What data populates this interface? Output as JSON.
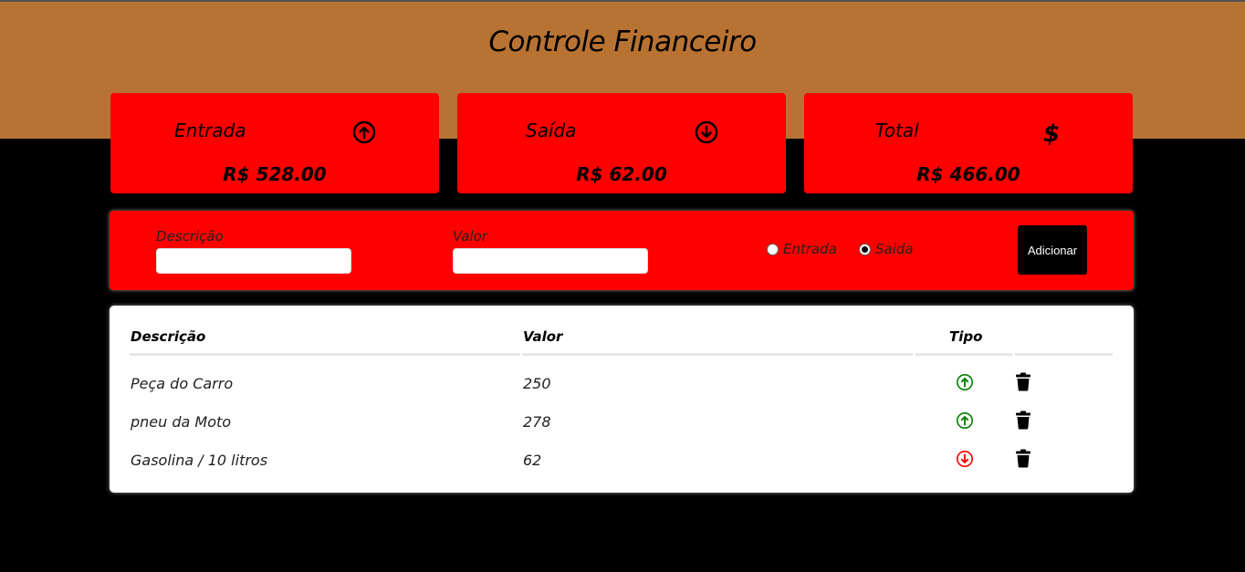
{
  "header": {
    "title": "Controle Financeiro"
  },
  "summary": {
    "entrada": {
      "label": "Entrada",
      "value": "R$ 528.00",
      "icon": "arrow-circle-up-icon"
    },
    "saida": {
      "label": "Saída",
      "value": "R$ 62.00",
      "icon": "arrow-circle-down-icon"
    },
    "total": {
      "label": "Total",
      "value": "R$ 466.00",
      "icon": "dollar-icon"
    }
  },
  "form": {
    "descricao_label": "Descrição",
    "descricao_value": "",
    "valor_label": "Valor",
    "valor_value": "",
    "radio_entrada_label": "Entrada",
    "radio_saida_label": "Saida",
    "selected_type": "saida",
    "add_button": "Adicionar"
  },
  "table": {
    "headers": {
      "descricao": "Descrição",
      "valor": "Valor",
      "tipo": "Tipo"
    },
    "rows": [
      {
        "descricao": "Peça do Carro",
        "valor": "250",
        "tipo": "entrada"
      },
      {
        "descricao": "pneu da Moto",
        "valor": "278",
        "tipo": "entrada"
      },
      {
        "descricao": "Gasolina / 10 litros",
        "valor": "62",
        "tipo": "saida"
      }
    ]
  },
  "colors": {
    "header_bg": "#b87333",
    "card_bg": "#ff0000",
    "entrada_icon": "#008000",
    "saida_icon": "#ff0000"
  }
}
